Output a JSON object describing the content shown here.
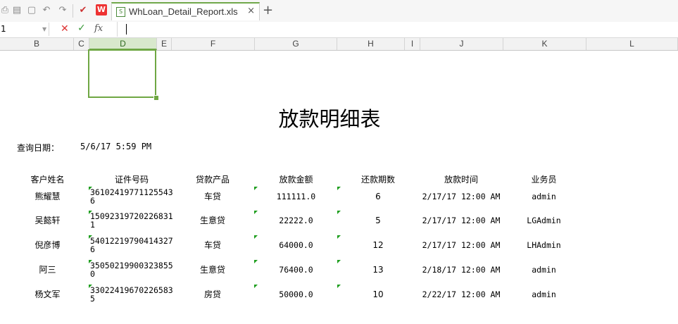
{
  "tab": {
    "title": "WhLoan_Detail_Report.xls",
    "close": "×",
    "add": "+"
  },
  "logo": {
    "text": "W"
  },
  "formula_bar": {
    "cell_ref": "1",
    "fx": "fx",
    "cancel": "✕",
    "confirm": "✓"
  },
  "columns": [
    "B",
    "C",
    "D",
    "E",
    "F",
    "G",
    "H",
    "I",
    "J",
    "K",
    "L"
  ],
  "active_column": "D",
  "report": {
    "title": "放款明细表",
    "query_label": "查询日期：",
    "query_value": "5/6/17 5:59 PM",
    "headers": [
      "客户姓名",
      "证件号码",
      "贷款产品",
      "放款金额",
      "还款期数",
      "放款时间",
      "业务员"
    ],
    "rows": [
      {
        "name": "熊耀慧",
        "id": "361024197711255436",
        "product": "车贷",
        "amount": "111111.0",
        "periods": "6",
        "time": "2/17/17 12:00 AM",
        "agent": "admin"
      },
      {
        "name": "吴懿轩",
        "id": "150923197202268311",
        "product": "生意贷",
        "amount": "22222.0",
        "periods": "5",
        "time": "2/17/17 12:00 AM",
        "agent": "LGAdmin"
      },
      {
        "name": "倪彦博",
        "id": "540122197904143276",
        "product": "车贷",
        "amount": "64000.0",
        "periods": "12",
        "time": "2/17/17 12:00 AM",
        "agent": "LHAdmin"
      },
      {
        "name": "阿三",
        "id": "350502199003238550",
        "product": "生意贷",
        "amount": "76400.0",
        "periods": "13",
        "time": "2/18/17 12:00 AM",
        "agent": "admin"
      },
      {
        "name": "杨文军",
        "id": "330224196702265835",
        "product": "房贷",
        "amount": "50000.0",
        "periods": "10",
        "time": "2/22/17 12:00 AM",
        "agent": "admin"
      }
    ]
  },
  "colors": {
    "accent": "#70a84b",
    "marker": "#1f9e1f",
    "cancel": "#dd3333"
  }
}
